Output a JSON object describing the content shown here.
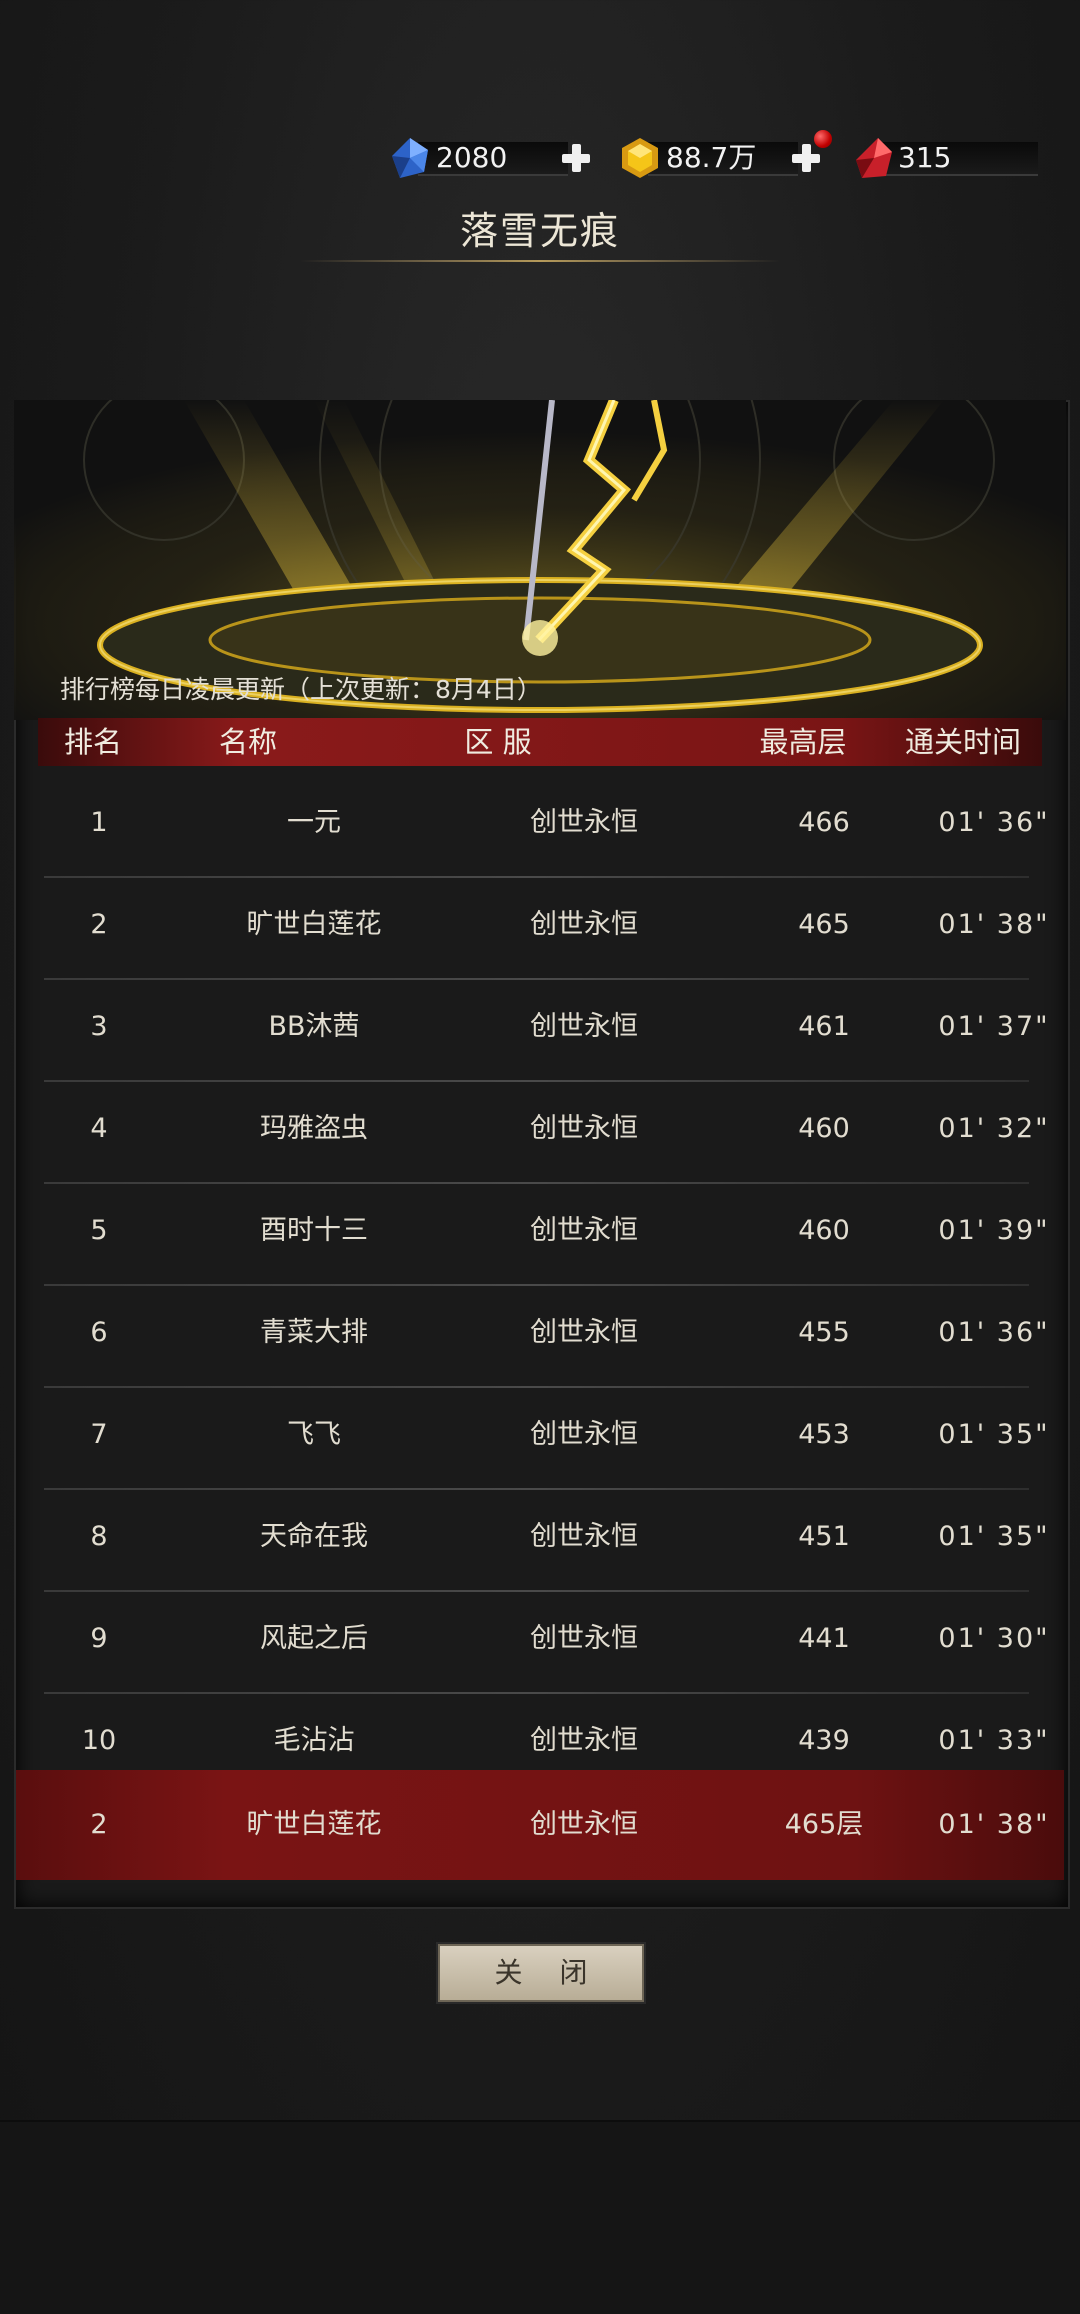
{
  "currencies": [
    {
      "name": "diamond",
      "value": "2080",
      "icon": "blue-gem-icon",
      "has_plus": true
    },
    {
      "name": "gold",
      "value": "88.7万",
      "icon": "gold-gem-icon",
      "has_plus": true,
      "has_notice": true
    },
    {
      "name": "ruby",
      "value": "315",
      "icon": "red-crystal-icon",
      "has_plus": false
    }
  ],
  "title": "落雪无痕",
  "update_note": "排行榜每日凌晨更新（上次更新：8月4日）",
  "columns": [
    "排名",
    "名称",
    "区 服",
    "最高层",
    "通关时间"
  ],
  "rows": [
    {
      "rank": "1",
      "name": "一元",
      "server": "创世永恒",
      "floor": "466",
      "time": "01' 36\""
    },
    {
      "rank": "2",
      "name": "旷世白莲花",
      "server": "创世永恒",
      "floor": "465",
      "time": "01' 38\""
    },
    {
      "rank": "3",
      "name": "BB沐茜",
      "server": "创世永恒",
      "floor": "461",
      "time": "01' 37\""
    },
    {
      "rank": "4",
      "name": "玛雅盗虫",
      "server": "创世永恒",
      "floor": "460",
      "time": "01' 32\""
    },
    {
      "rank": "5",
      "name": "酉时十三",
      "server": "创世永恒",
      "floor": "460",
      "time": "01' 39\""
    },
    {
      "rank": "6",
      "name": "青菜大排",
      "server": "创世永恒",
      "floor": "455",
      "time": "01' 36\""
    },
    {
      "rank": "7",
      "name": "飞飞",
      "server": "创世永恒",
      "floor": "453",
      "time": "01' 35\""
    },
    {
      "rank": "8",
      "name": "天命在我",
      "server": "创世永恒",
      "floor": "451",
      "time": "01' 35\""
    },
    {
      "rank": "9",
      "name": "风起之后",
      "server": "创世永恒",
      "floor": "441",
      "time": "01' 30\""
    },
    {
      "rank": "10",
      "name": "毛沾沾",
      "server": "创世永恒",
      "floor": "439",
      "time": "01' 33\""
    }
  ],
  "my_rank": {
    "rank": "2",
    "name": "旷世白莲花",
    "server": "创世永恒",
    "floor": "465层",
    "time": "01' 38\""
  },
  "close_label": "关 闭",
  "colors": {
    "header_red": "#8a1a1a",
    "highlight_red": "#7a1414",
    "gold": "#f5c518"
  }
}
